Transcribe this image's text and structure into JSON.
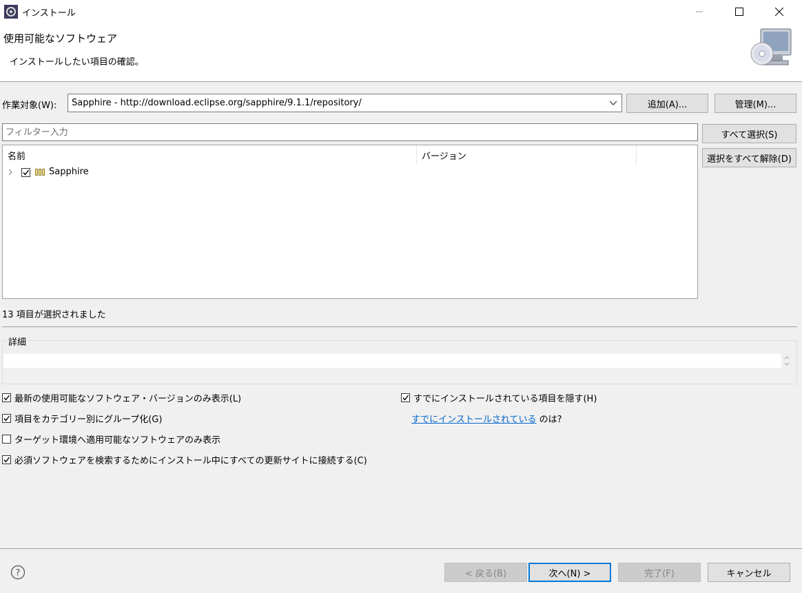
{
  "window": {
    "title": "インストール",
    "minimize_icon": "minimize-icon",
    "maximize_icon": "maximize-icon",
    "close_icon": "close-icon"
  },
  "header": {
    "title": "使用可能なソフトウェア",
    "description": "インストールしたい項目の確認。"
  },
  "work_with": {
    "label": "作業対象(W):",
    "value": "Sapphire - http://download.eclipse.org/sapphire/9.1.1/repository/",
    "add_button": "追加(A)...",
    "manage_button": "管理(M)..."
  },
  "filter": {
    "placeholder": "フィルター入力",
    "value": ""
  },
  "side_buttons": {
    "select_all": "すべて選択(S)",
    "deselect_all": "選択をすべて解除(D)"
  },
  "tree": {
    "columns": [
      "名前",
      "バージョン"
    ],
    "rows": [
      {
        "name": "Sapphire",
        "version": "",
        "checked": true,
        "expanded": false
      }
    ]
  },
  "status": "13 項目が選択されました",
  "details": {
    "label": "詳細",
    "text": ""
  },
  "options": {
    "latest_only": {
      "label": "最新の使用可能なソフトウェア・バージョンのみ表示(L)",
      "checked": true
    },
    "group_by_category": {
      "label": "項目をカテゴリー別にグループ化(G)",
      "checked": true
    },
    "target_only": {
      "label": "ターゲット環境へ適用可能なソフトウェアのみ表示",
      "checked": false
    },
    "contact_all_sites": {
      "label": "必須ソフトウェアを検索するためにインストール中にすべての更新サイトに接続する(C)",
      "checked": true
    },
    "hide_installed": {
      "label": "すでにインストールされている項目を隠す(H)",
      "checked": true
    },
    "already_installed_link": "すでにインストールされている",
    "already_installed_suffix": "のは?"
  },
  "footer": {
    "help_icon": "help-icon",
    "back": "< 戻る(B)",
    "next": "次へ(N) >",
    "finish": "完了(F)",
    "cancel": "キャンセル"
  }
}
